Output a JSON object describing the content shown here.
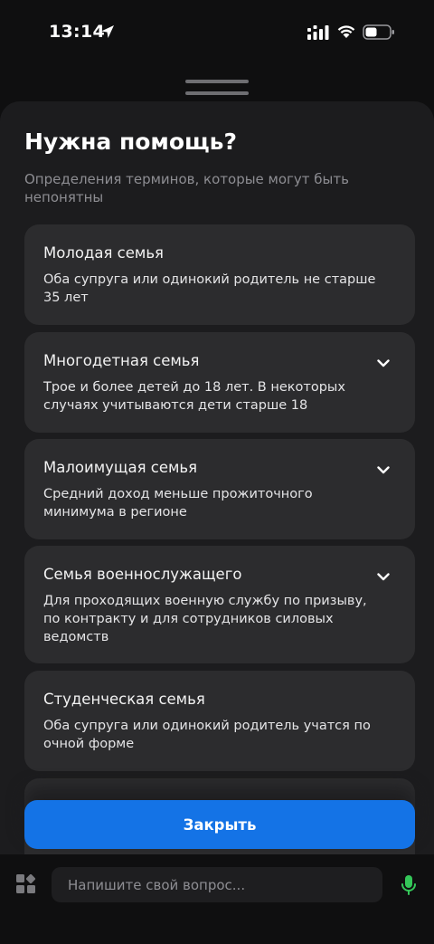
{
  "status_bar": {
    "time": "13:14"
  },
  "sheet": {
    "title": "Нужна помощь?",
    "subtitle": "Определения терминов, которые могут быть непонятны",
    "cards": [
      {
        "title": "Молодая семья",
        "text": "Оба супруга или одинокий родитель не старше 35 лет"
      },
      {
        "title": "Многодетная семья",
        "text": "Трое и более детей до 18 лет. В некоторых случаях учитываются дети старше 18"
      },
      {
        "title": "Малоимущая семья",
        "text": "Средний доход меньше прожиточного минимума в регионе"
      },
      {
        "title": "Семья военнослужащего",
        "text": "Для проходящих военную службу по призыву, по контракту и для сотрудников силовых ведомств"
      },
      {
        "title": "Студенческая семья",
        "text": "Оба супруга или одинокий родитель учатся по очной форме"
      }
    ],
    "close_label": "Закрыть"
  },
  "chat": {
    "placeholder": "Напишите свой вопрос..."
  },
  "colors": {
    "accent": "#1473e6",
    "mic": "#34c759",
    "sheet_bg": "#1c1c1e",
    "card_bg": "#2c2c2e"
  },
  "icons": [
    "location-arrow-icon",
    "signal-icon",
    "wifi-icon",
    "battery-icon",
    "chevron-down-icon",
    "grid-icon",
    "mic-icon"
  ]
}
